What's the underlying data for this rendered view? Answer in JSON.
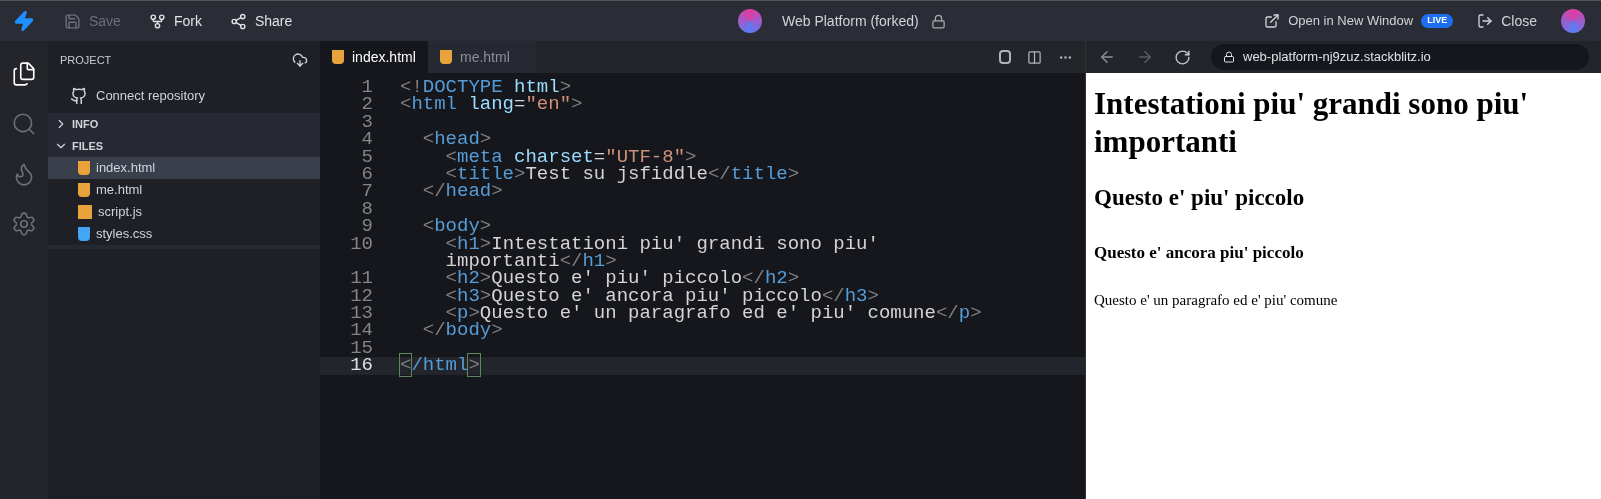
{
  "toolbar": {
    "buttons": [
      {
        "kind": "save",
        "label": "Save",
        "disabled": true
      },
      {
        "kind": "fork",
        "label": "Fork",
        "disabled": false
      },
      {
        "kind": "share",
        "label": "Share",
        "disabled": false
      }
    ],
    "title": "Web Platform (forked)",
    "open_window": {
      "label": "Open in New Window",
      "badge": "LIVE"
    },
    "close": "Close"
  },
  "activity_bar": [
    {
      "kind": "files",
      "selected": true
    },
    {
      "kind": "search",
      "selected": false
    },
    {
      "kind": "firebase",
      "selected": false
    },
    {
      "kind": "settings",
      "selected": false
    }
  ],
  "sidebar": {
    "header": "PROJECT",
    "connect": "Connect repository",
    "sections": [
      {
        "label": "INFO",
        "expanded": false
      },
      {
        "label": "FILES",
        "expanded": true
      }
    ],
    "files": [
      {
        "name": "index.html",
        "kind": "html",
        "selected": true
      },
      {
        "name": "me.html",
        "kind": "html",
        "selected": false
      },
      {
        "name": "script.js",
        "kind": "js",
        "selected": false
      },
      {
        "name": "styles.css",
        "kind": "css",
        "selected": false
      }
    ]
  },
  "tabs": [
    {
      "label": "index.html",
      "kind": "html",
      "selected": true
    },
    {
      "label": "me.html",
      "kind": "html",
      "selected": false
    }
  ],
  "code": [
    {
      "number": "1",
      "current": false,
      "tokens": [
        {
          "kind": "punct",
          "text": "<!"
        },
        {
          "kind": "tag",
          "text": "DOCTYPE"
        },
        {
          "kind": "attr",
          "text": " html"
        },
        {
          "kind": "punct",
          "text": ">"
        }
      ]
    },
    {
      "number": "2",
      "current": false,
      "tokens": [
        {
          "kind": "punct",
          "text": "<"
        },
        {
          "kind": "tag",
          "text": "html"
        },
        {
          "kind": "attr",
          "text": " lang"
        },
        {
          "kind": "text",
          "text": "="
        },
        {
          "kind": "string",
          "text": "\"en\""
        },
        {
          "kind": "punct",
          "text": ">"
        }
      ]
    },
    {
      "number": "3",
      "current": false
    },
    {
      "number": "4",
      "current": false,
      "tokens": [
        {
          "kind": "punct",
          "text": "  <"
        },
        {
          "kind": "tag",
          "text": "head"
        },
        {
          "kind": "punct",
          "text": ">"
        }
      ]
    },
    {
      "number": "5",
      "current": false,
      "tokens": [
        {
          "kind": "punct",
          "text": "    <"
        },
        {
          "kind": "tag",
          "text": "meta"
        },
        {
          "kind": "attr",
          "text": " charset"
        },
        {
          "kind": "text",
          "text": "="
        },
        {
          "kind": "string",
          "text": "\"UTF-8\""
        },
        {
          "kind": "punct",
          "text": ">"
        }
      ]
    },
    {
      "number": "6",
      "current": false,
      "tokens": [
        {
          "kind": "punct",
          "text": "    <"
        },
        {
          "kind": "tag",
          "text": "title"
        },
        {
          "kind": "punct",
          "text": ">"
        },
        {
          "kind": "text",
          "text": "Test su jsfiddle"
        },
        {
          "kind": "punct",
          "text": "</"
        },
        {
          "kind": "tag",
          "text": "title"
        },
        {
          "kind": "punct",
          "text": ">"
        }
      ]
    },
    {
      "number": "7",
      "current": false,
      "tokens": [
        {
          "kind": "punct",
          "text": "  </"
        },
        {
          "kind": "tag",
          "text": "head"
        },
        {
          "kind": "punct",
          "text": ">"
        }
      ]
    },
    {
      "number": "8",
      "current": false
    },
    {
      "number": "9",
      "current": false,
      "tokens": [
        {
          "kind": "punct",
          "text": "  <"
        },
        {
          "kind": "tag",
          "text": "body"
        },
        {
          "kind": "punct",
          "text": ">"
        }
      ]
    },
    {
      "number": "10",
      "current": false,
      "tokens": [
        {
          "kind": "punct",
          "text": "    <"
        },
        {
          "kind": "tag",
          "text": "h1"
        },
        {
          "kind": "punct",
          "text": ">"
        },
        {
          "kind": "text",
          "text": "Intestationi piu' grandi sono piu'"
        }
      ]
    },
    {
      "current": false,
      "tokens": [
        {
          "kind": "text",
          "text": "    importanti"
        },
        {
          "kind": "punct",
          "text": "</"
        },
        {
          "kind": "tag",
          "text": "h1"
        },
        {
          "kind": "punct",
          "text": ">"
        }
      ]
    },
    {
      "number": "11",
      "current": false,
      "tokens": [
        {
          "kind": "punct",
          "text": "    <"
        },
        {
          "kind": "tag",
          "text": "h2"
        },
        {
          "kind": "punct",
          "text": ">"
        },
        {
          "kind": "text",
          "text": "Questo e' piu' piccolo"
        },
        {
          "kind": "punct",
          "text": "</"
        },
        {
          "kind": "tag",
          "text": "h2"
        },
        {
          "kind": "punct",
          "text": ">"
        }
      ]
    },
    {
      "number": "12",
      "current": false,
      "tokens": [
        {
          "kind": "punct",
          "text": "    <"
        },
        {
          "kind": "tag",
          "text": "h3"
        },
        {
          "kind": "punct",
          "text": ">"
        },
        {
          "kind": "text",
          "text": "Questo e' ancora piu' piccolo"
        },
        {
          "kind": "punct",
          "text": "</"
        },
        {
          "kind": "tag",
          "text": "h3"
        },
        {
          "kind": "punct",
          "text": ">"
        }
      ]
    },
    {
      "number": "13",
      "current": false,
      "tokens": [
        {
          "kind": "punct",
          "text": "    <"
        },
        {
          "kind": "tag",
          "text": "p"
        },
        {
          "kind": "punct",
          "text": ">"
        },
        {
          "kind": "text",
          "text": "Questo e' un paragrafo ed e' piu' comune"
        },
        {
          "kind": "punct",
          "text": "</"
        },
        {
          "kind": "tag",
          "text": "p"
        },
        {
          "kind": "punct",
          "text": ">"
        }
      ]
    },
    {
      "number": "14",
      "current": false,
      "tokens": [
        {
          "kind": "punct",
          "text": "  </"
        },
        {
          "kind": "tag",
          "text": "body"
        },
        {
          "kind": "punct",
          "text": ">"
        }
      ]
    },
    {
      "number": "15",
      "current": false
    },
    {
      "number": "16",
      "current": true,
      "tokens": [
        {
          "kind": "match",
          "text": "<"
        },
        {
          "kind": "tag",
          "text": "/html"
        },
        {
          "kind": "match",
          "text": ">"
        }
      ]
    }
  ],
  "preview": {
    "url": "web-platform-nj9zuz.stackblitz.io",
    "back_disabled": false,
    "forward_disabled": true,
    "content": [
      {
        "kind": "h1",
        "text": "Intestationi piu' grandi sono piu' importanti"
      },
      {
        "kind": "h2",
        "text": "Questo e' piu' piccolo"
      },
      {
        "kind": "h3",
        "text": "Questo e' ancora piu' piccolo"
      },
      {
        "kind": "p",
        "text": "Questo e' un paragrafo ed e' piu' comune"
      }
    ]
  }
}
